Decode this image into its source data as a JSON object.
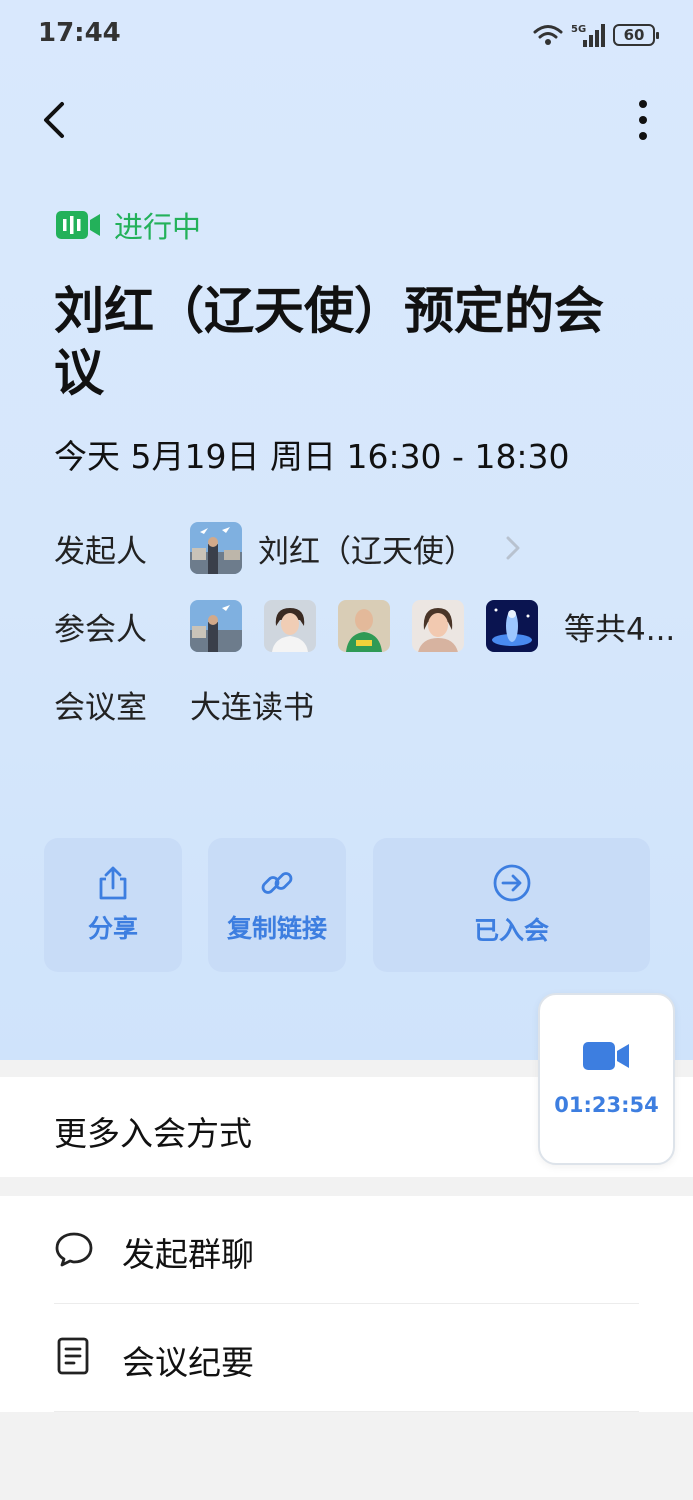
{
  "status_bar": {
    "time": "17:44",
    "network": "5G",
    "battery": "60"
  },
  "meeting": {
    "status": "进行中",
    "title": "刘红（辽天使）预定的会议",
    "datetime": "今天 5月19日 周日 16:30 - 18:30",
    "host_label": "发起人",
    "host_name": "刘红（辽天使）",
    "attendees_label": "参会人",
    "attendees_more": "等共4...",
    "room_label": "会议室",
    "room_name": "大连读书"
  },
  "actions": {
    "share": "分享",
    "copy_link": "复制链接",
    "joined": "已入会"
  },
  "floating": {
    "timer": "01:23:54"
  },
  "list": {
    "more_ways": "更多入会方式",
    "group_chat": "发起群聊",
    "minutes": "会议纪要"
  },
  "colors": {
    "accent": "#3d7ee0",
    "live": "#23b15a",
    "background_top": "#d9e8fd"
  }
}
